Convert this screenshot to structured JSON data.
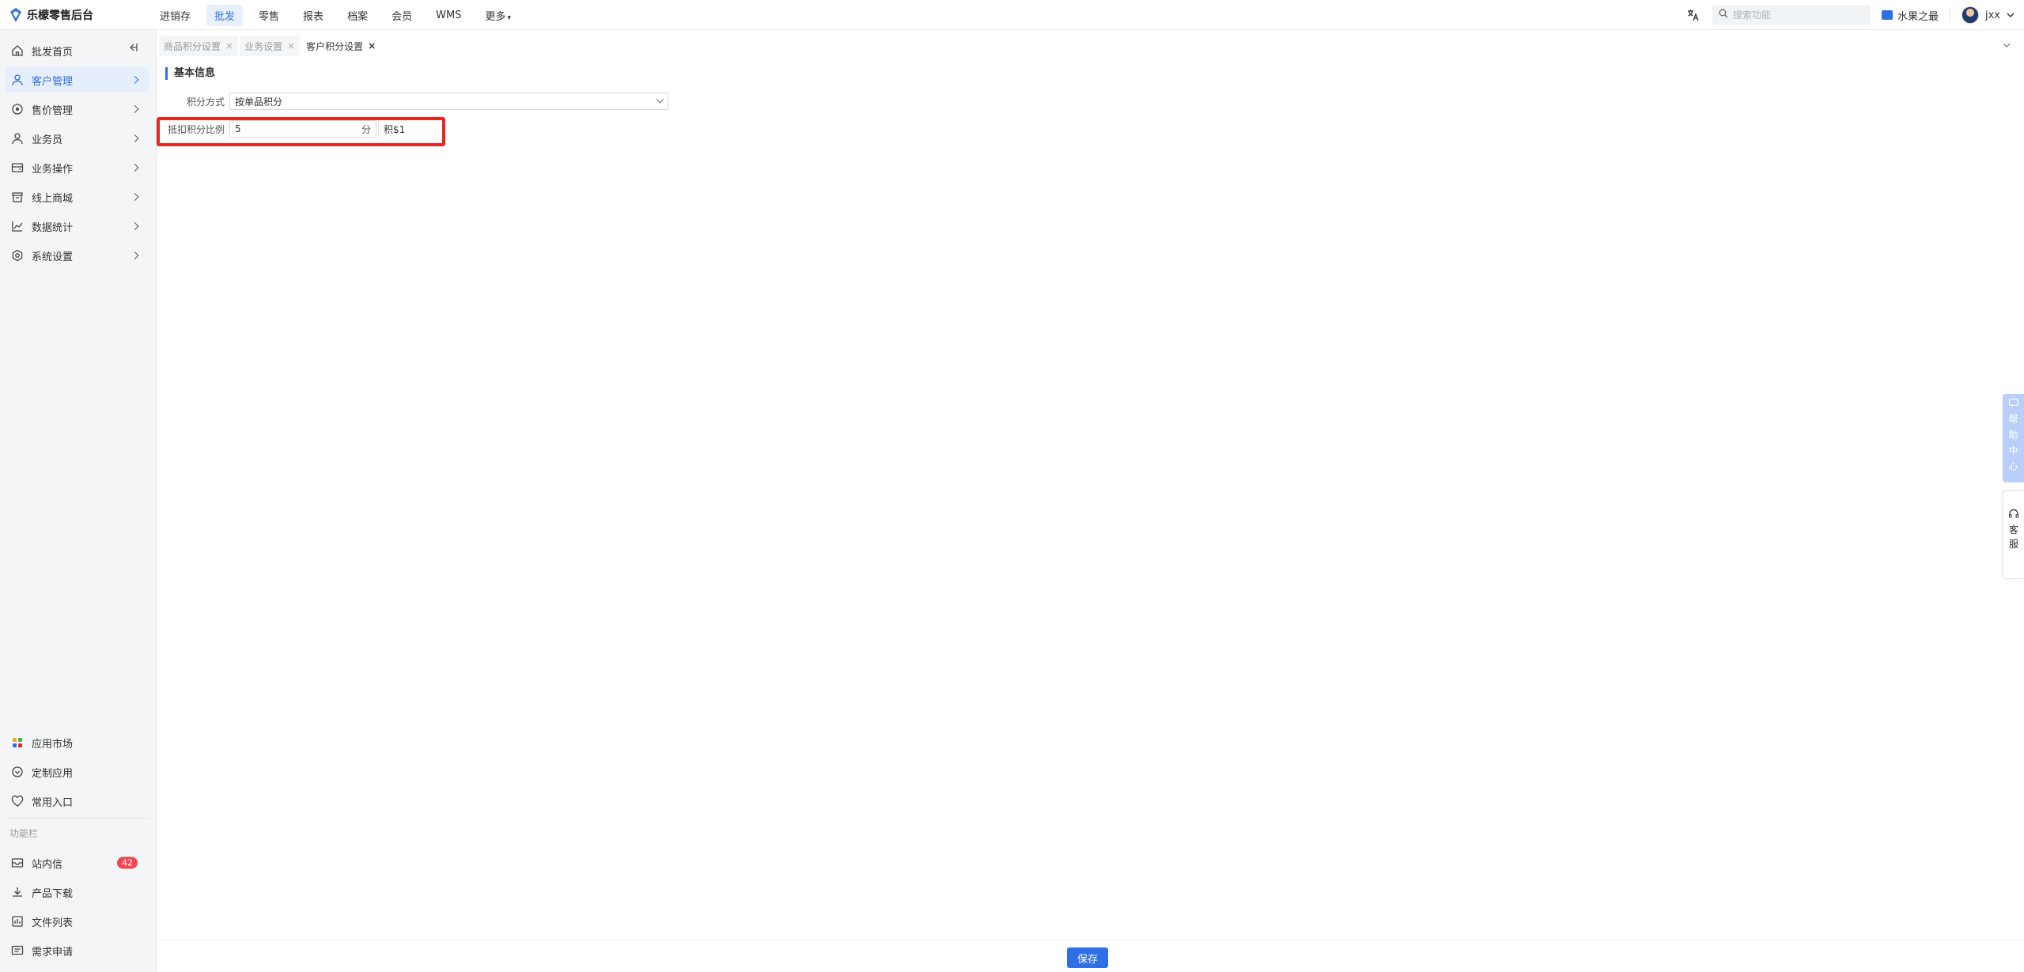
{
  "app": {
    "title": "乐檬零售后台"
  },
  "topnav": {
    "items": [
      {
        "label": "进销存",
        "active": false
      },
      {
        "label": "批发",
        "active": true
      },
      {
        "label": "零售",
        "active": false
      },
      {
        "label": "报表",
        "active": false
      },
      {
        "label": "档案",
        "active": false
      },
      {
        "label": "会员",
        "active": false
      },
      {
        "label": "WMS",
        "active": false
      }
    ],
    "more_label": "更多"
  },
  "header": {
    "search_placeholder": "搜索功能",
    "store_name": "水果之最",
    "user_name": "jxx",
    "translate_icon": "translate-icon"
  },
  "sidebar": {
    "items": [
      {
        "label": "批发首页",
        "icon": "home-icon"
      },
      {
        "label": "客户管理",
        "icon": "user-icon",
        "active": true
      },
      {
        "label": "售价管理",
        "icon": "price-icon"
      },
      {
        "label": "业务员",
        "icon": "user-icon"
      },
      {
        "label": "业务操作",
        "icon": "folder-icon"
      },
      {
        "label": "线上商城",
        "icon": "store-icon"
      },
      {
        "label": "数据统计",
        "icon": "chart-icon"
      },
      {
        "label": "系统设置",
        "icon": "gear-icon"
      }
    ],
    "bottom_items": [
      {
        "label": "应用市场",
        "icon": "app-market-icon"
      },
      {
        "label": "定制应用",
        "icon": "custom-app-icon"
      },
      {
        "label": "常用入口",
        "icon": "heart-icon"
      }
    ],
    "section_label": "功能栏",
    "function_items": [
      {
        "label": "站内信",
        "icon": "mail-icon",
        "badge": "42"
      },
      {
        "label": "产品下载",
        "icon": "download-icon"
      },
      {
        "label": "文件列表",
        "icon": "file-list-icon"
      },
      {
        "label": "需求申请",
        "icon": "request-icon"
      }
    ]
  },
  "tabs": [
    {
      "label": "商品积分设置",
      "active": false
    },
    {
      "label": "业务设置",
      "active": false
    },
    {
      "label": "客户积分设置",
      "active": true
    }
  ],
  "form": {
    "section_title": "基本信息",
    "points_method_label": "积分方式",
    "points_method_value": "按单品积分",
    "ratio_label": "抵扣积分比例",
    "ratio_value": "5",
    "ratio_unit": "分",
    "ratio_suffix": "积$1"
  },
  "footer": {
    "save_label": "保存"
  },
  "float_tabs": {
    "help": [
      "帮",
      "助",
      "中",
      "心"
    ],
    "service": [
      "客",
      "服"
    ]
  },
  "colors": {
    "accent": "#2f6fe6",
    "highlight": "#e8261f",
    "badge": "#f5454f"
  }
}
